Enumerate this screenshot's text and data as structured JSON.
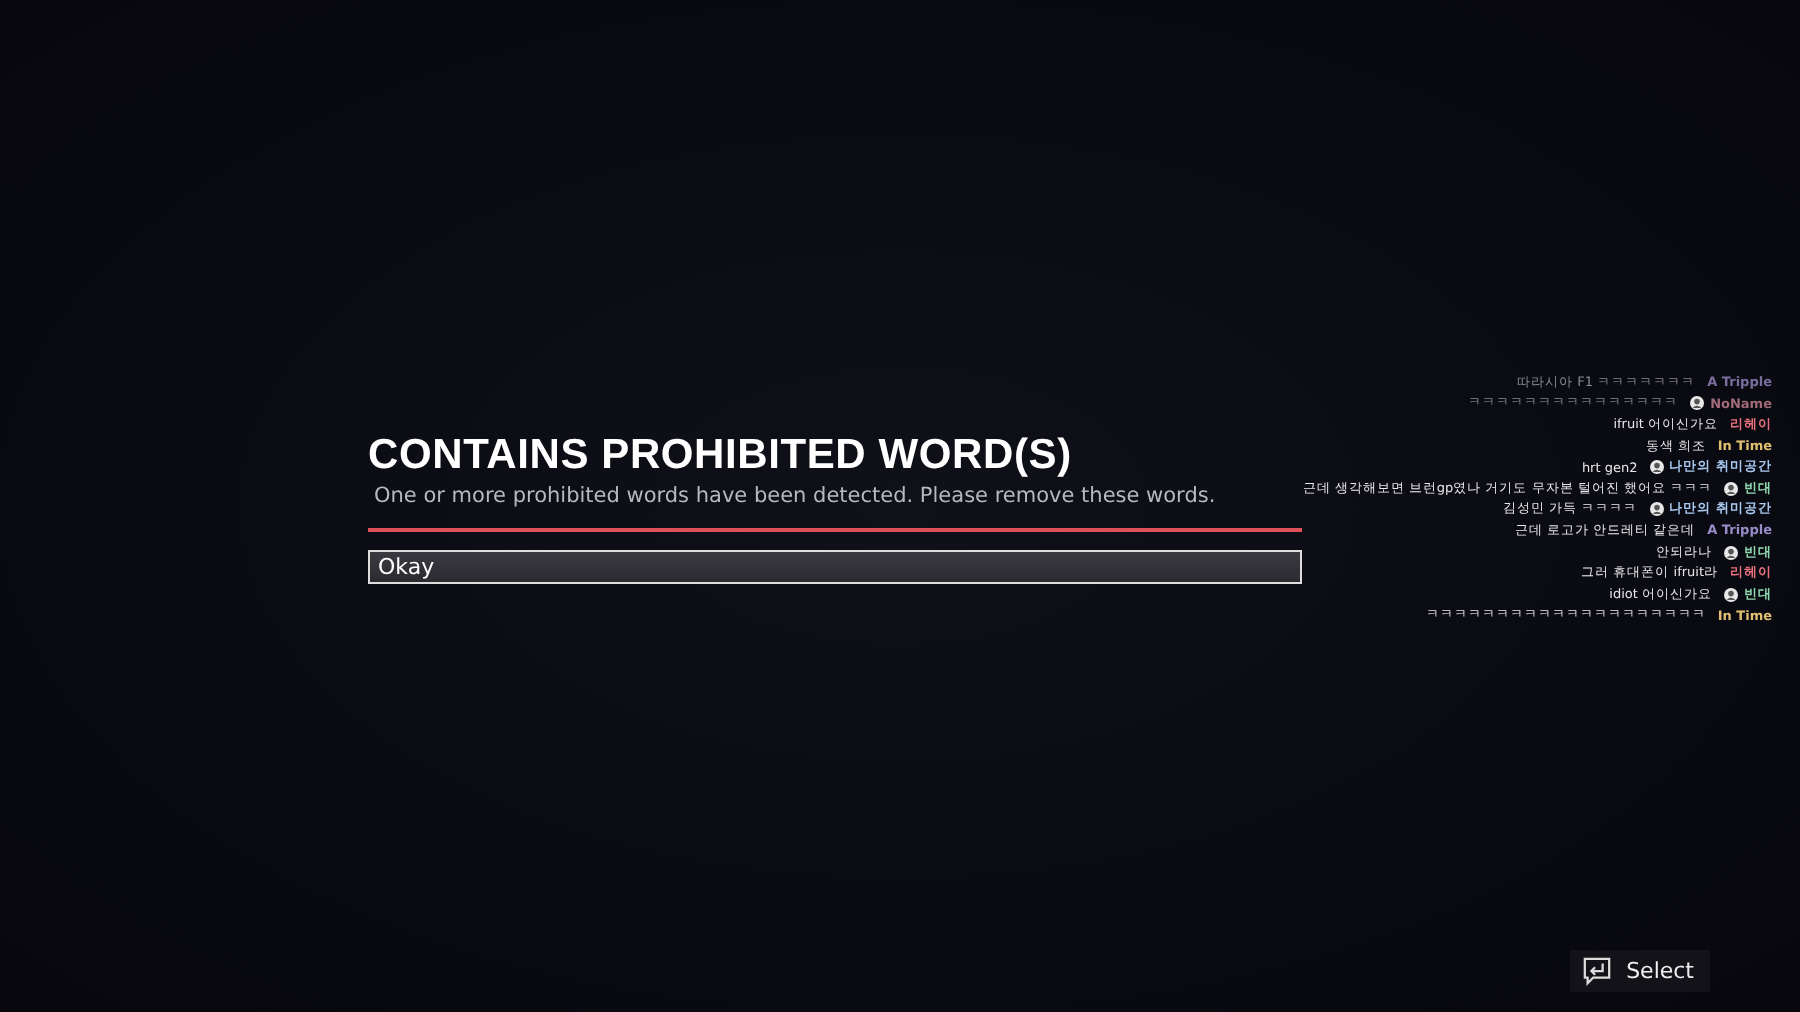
{
  "dialog": {
    "title": "CONTAINS PROHIBITED WORD(S)",
    "message": "One or more prohibited words have been detected. Please remove these words.",
    "options": [
      {
        "label": "Okay",
        "selected": true
      }
    ]
  },
  "chat": [
    {
      "text": "따라시아 F1 ㅋㅋㅋㅋㅋㅋㅋ",
      "author": "A Tripple",
      "color": "#7a6e9e",
      "badge": false,
      "faded": true
    },
    {
      "text": "ㅋㅋㅋㅋㅋㅋㅋㅋㅋㅋㅋㅋㅋㅋㅋ",
      "author": "NoName",
      "color": "#a06a78",
      "badge": true,
      "faded": true
    },
    {
      "text": "ifruit 어이신가요",
      "author": "리헤이",
      "color": "#e8707c",
      "badge": false,
      "faded": false
    },
    {
      "text": "동색 희조",
      "author": "In Time",
      "color": "#e0c070",
      "badge": false,
      "faded": false
    },
    {
      "text": "hrt gen2",
      "author": "나만의 취미공간",
      "color": "#a8c8f0",
      "badge": true,
      "faded": false
    },
    {
      "text": "근데 생각해보면 브런gp였나 거기도 무자본 털어진 했어요 ㅋㅋㅋ",
      "author": "빈대",
      "color": "#90d8b0",
      "badge": true,
      "faded": false
    },
    {
      "text": "김성민 가득 ㅋㅋㅋㅋ",
      "author": "나만의 취미공간",
      "color": "#a8c8f0",
      "badge": true,
      "faded": false
    },
    {
      "text": "근데 로고가 안드레티 같은데",
      "author": "A Tripple",
      "color": "#9a8cc8",
      "badge": false,
      "faded": false
    },
    {
      "text": "안되라나",
      "author": "빈대",
      "color": "#90d8b0",
      "badge": true,
      "faded": false
    },
    {
      "text": "그러 휴대폰이 ifruit라",
      "author": "리헤이",
      "color": "#e8707c",
      "badge": false,
      "faded": false
    },
    {
      "text": "idiot 어이신가요",
      "author": "빈대",
      "color": "#90d8b0",
      "badge": true,
      "faded": false
    },
    {
      "text": "ㅋㅋㅋㅋㅋㅋㅋㅋㅋㅋㅋㅋㅋㅋㅋㅋㅋㅋㅋㅋ",
      "author": "In Time",
      "color": "#e0c070",
      "badge": false,
      "faded": false
    }
  ],
  "footer": {
    "select_label": "Select"
  }
}
